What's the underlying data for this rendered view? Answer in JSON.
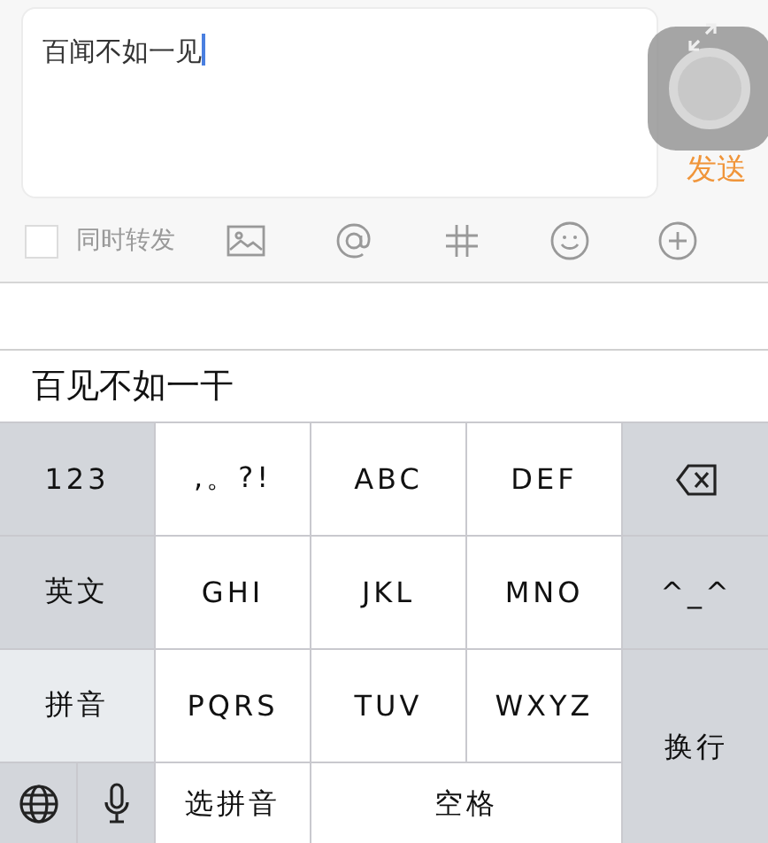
{
  "composer": {
    "value": "百闻不如一见",
    "send": "发送",
    "repost": {
      "label": "同时转发",
      "checked": false
    },
    "tools": [
      {
        "kind": "image"
      },
      {
        "kind": "mention"
      },
      {
        "kind": "topic"
      },
      {
        "kind": "emoji"
      },
      {
        "kind": "more"
      }
    ]
  },
  "candidates": [
    "百见不如一干"
  ],
  "keyboard": {
    "keys": [
      {
        "kind": "function",
        "label": "123"
      },
      {
        "kind": "letter",
        "label": ",。?!"
      },
      {
        "kind": "letter",
        "label": "ABC"
      },
      {
        "kind": "letter",
        "label": "DEF"
      },
      {
        "kind": "delete"
      },
      {
        "kind": "mode",
        "label": "英文",
        "selected": false
      },
      {
        "kind": "letter",
        "label": "GHI"
      },
      {
        "kind": "letter",
        "label": "JKL"
      },
      {
        "kind": "letter",
        "label": "MNO"
      },
      {
        "kind": "function",
        "label": "^_^"
      },
      {
        "kind": "mode",
        "label": "拼音",
        "selected": true
      },
      {
        "kind": "letter",
        "label": "PQRS"
      },
      {
        "kind": "letter",
        "label": "TUV"
      },
      {
        "kind": "letter",
        "label": "WXYZ"
      },
      {
        "kind": "function",
        "label": "换行"
      },
      {
        "kind": "globe"
      },
      {
        "kind": "mic"
      },
      {
        "kind": "letter",
        "label": "选拼音"
      },
      {
        "kind": "letter",
        "label": "空格"
      }
    ]
  }
}
